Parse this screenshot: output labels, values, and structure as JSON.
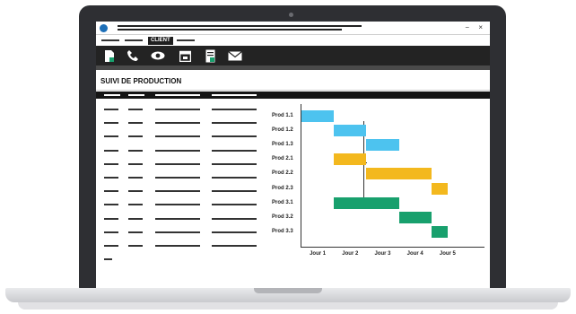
{
  "window": {
    "tabs": [
      "",
      "",
      "CLIENT",
      ""
    ],
    "active_tab": "CLIENT",
    "controls": [
      "−",
      "×"
    ]
  },
  "toolbar": {
    "icons": [
      "new-document-icon",
      "phone-icon",
      "eye-icon",
      "calendar-icon",
      "report-icon",
      "mail-icon"
    ]
  },
  "page": {
    "title": "SUIVI DE PRODUCTION"
  },
  "colors": {
    "blue": "#4dc3ef",
    "yellow": "#f3b81e",
    "green": "#18a06d",
    "dark": "#1f1f1f"
  },
  "chart_data": {
    "type": "gantt",
    "categories": [
      "Prod 1.1",
      "Prod 1.2",
      "Prod 1.3",
      "Prod 2.1",
      "Prod 2.2",
      "Prod 2.3",
      "Prod 3.1",
      "Prod 3.2",
      "Prod 3.3"
    ],
    "x_ticks": [
      "Jour 1",
      "Jour 2",
      "Jour 3",
      "Jour 4",
      "Jour 5"
    ],
    "tasks": [
      {
        "label": "Prod 1.1",
        "start": 1.0,
        "end": 2.0,
        "color": "#4dc3ef"
      },
      {
        "label": "Prod 1.2",
        "start": 2.0,
        "end": 3.0,
        "color": "#4dc3ef"
      },
      {
        "label": "Prod 1.3",
        "start": 3.0,
        "end": 4.0,
        "color": "#4dc3ef"
      },
      {
        "label": "Prod 2.1",
        "start": 2.0,
        "end": 3.0,
        "color": "#f3b81e"
      },
      {
        "label": "Prod 2.2",
        "start": 3.0,
        "end": 5.0,
        "color": "#f3b81e"
      },
      {
        "label": "Prod 2.3",
        "start": 5.0,
        "end": 5.5,
        "color": "#f3b81e"
      },
      {
        "label": "Prod 3.1",
        "start": 2.0,
        "end": 4.0,
        "color": "#18a06d"
      },
      {
        "label": "Prod 3.2",
        "start": 4.0,
        "end": 5.0,
        "color": "#18a06d"
      },
      {
        "label": "Prod 3.3",
        "start": 5.0,
        "end": 5.5,
        "color": "#18a06d"
      }
    ],
    "title": "",
    "xlabel": "",
    "ylabel": ""
  }
}
